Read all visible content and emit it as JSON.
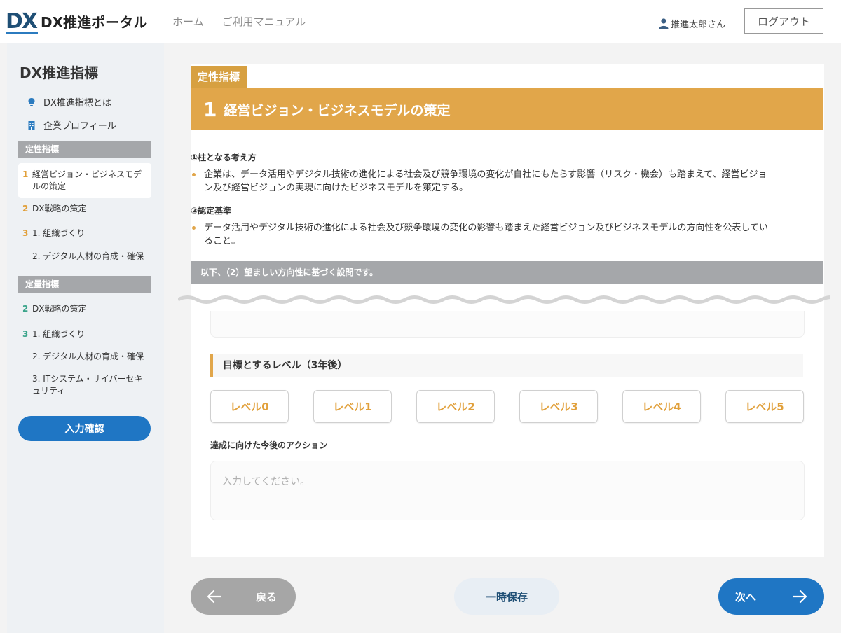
{
  "header": {
    "logo_mark": "DX",
    "logo_text": "DX推進ポータル",
    "nav": [
      "ホーム",
      "ご利用マニュアル"
    ],
    "user_name": "推進太郎さん",
    "logout_label": "ログアウト"
  },
  "sidebar": {
    "title": "DX推進指標",
    "links": [
      {
        "label": "DX推進指標とは",
        "icon": "lightbulb-icon"
      },
      {
        "label": "企業プロフィール",
        "icon": "building-icon"
      }
    ],
    "qualitative": {
      "heading": "定性指標",
      "items": [
        {
          "num": "1",
          "label": "経営ビジョン・ビジネスモデルの策定",
          "active": true
        },
        {
          "num": "2",
          "label": "DX戦略の策定"
        },
        {
          "num": "3",
          "label": "1. 組織づくり"
        },
        {
          "num": "",
          "label": "2. デジタル人材の育成・確保"
        }
      ]
    },
    "quantitative": {
      "heading": "定量指標",
      "items": [
        {
          "num": "2",
          "label": "DX戦略の策定"
        },
        {
          "num": "3",
          "label": "1. 組織づくり"
        },
        {
          "num": "",
          "label": "2. デジタル人材の育成・確保"
        },
        {
          "num": "",
          "label": "3. ITシステム・サイバーセキュリティ"
        }
      ]
    },
    "confirm_label": "入力確認"
  },
  "main": {
    "tag": "定性指標",
    "banner_num": "1",
    "banner_title": "経営ビジョン・ビジネスモデルの策定",
    "section1_heading": "①柱となる考え方",
    "section1_line1": "企業は、データ活用やデジタル技術の進化による社会及び競争環境の変化が自社にもたらす影響（リスク・機会）も踏まえて、経営ビジョ",
    "section1_line2": "ン及び経営ビジョンの実現に向けたビジネスモデルを策定する。",
    "section2_heading": "②認定基準",
    "section2_line1": "データ活用やデジタル技術の進化による社会及び競争環境の変化の影響も踏まえた経営ビジョン及びビジネスモデルの方向性を公表してい",
    "section2_line2": "ること。",
    "notice": "以下、（2）望ましい方向性に基づく設問です。",
    "target_heading": "目標とするレベル（3年後）",
    "levels": [
      "レベル0",
      "レベル1",
      "レベル2",
      "レベル3",
      "レベル4",
      "レベル5"
    ],
    "action_label": "達成に向けた今後のアクション",
    "action_placeholder": "入力してください。"
  },
  "footer": {
    "back_label": "戻る",
    "save_label": "一時保存",
    "next_label": "次へ"
  },
  "colors": {
    "accent_orange": "#e1a64a",
    "primary_blue": "#1f76c4",
    "gray_head": "#a5a7aa"
  }
}
